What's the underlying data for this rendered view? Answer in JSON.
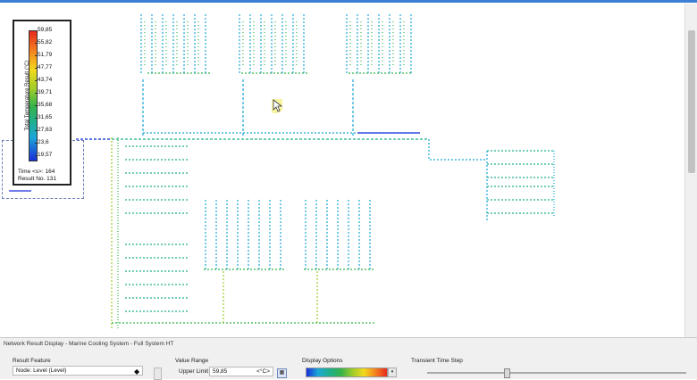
{
  "legend": {
    "title": "Total Temperature Result (°C)",
    "ticks": [
      "59,85",
      "55,82",
      "51,79",
      "47,77",
      "43,74",
      "39,71",
      "35,68",
      "31,65",
      "27,63",
      "23,6",
      "19,57"
    ],
    "time_label": "Time <s>: 164",
    "result_label": "Result No. 131"
  },
  "panel": {
    "title": "Network Result Display - Marine Cooling System - Full System HT",
    "result_feature_label": "Result Feature",
    "result_feature_value": "Node: Level (Level)",
    "value_range_label": "Value Range",
    "upper_limit_label": "Upper Limit",
    "upper_limit_value": "59,85",
    "upper_limit_unit": "<°C>",
    "display_options_label": "Display Options",
    "transient_label": "Transient Time Step"
  },
  "colors": {
    "accent": "#3d7fd6",
    "hot": "#e8281b",
    "cold": "#1a2fd9"
  },
  "icons": {
    "cursor": "pointer-cursor-icon",
    "calculator": "calculator-icon",
    "diamond": "diamond-icon"
  }
}
